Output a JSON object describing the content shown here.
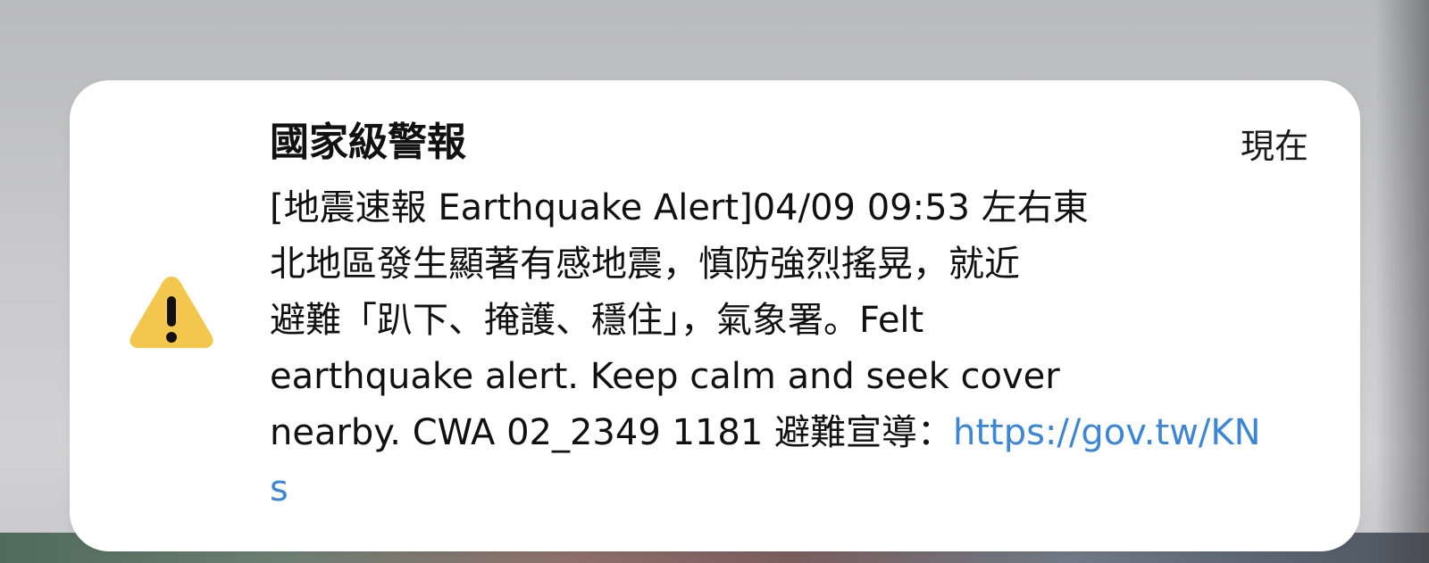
{
  "notification": {
    "icon": "warning-triangle-icon",
    "title": "國家級警報",
    "timestamp": "現在",
    "message_lines": [
      "[地震速報 Earthquake Alert]04/09 09:53 左右東",
      "北地區發生顯著有感地震，慎防強烈搖晃，就近",
      "避難「趴下、掩護、穩住」，氣象署。Felt",
      "earthquake alert. Keep calm and seek cover",
      "nearby. CWA 02_2349 1181 避難宣導："
    ],
    "link_text": "https://gov.tw/KNs",
    "colors": {
      "icon_fill": "#f3c74d",
      "link": "#3b86d6",
      "card_background": "#ffffff"
    }
  }
}
